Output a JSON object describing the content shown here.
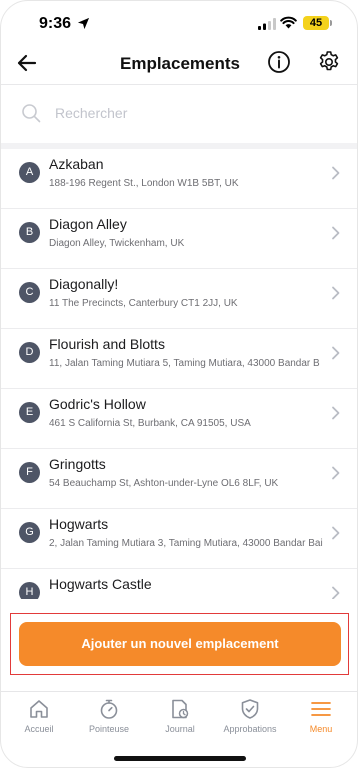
{
  "status_bar": {
    "time": "9:36",
    "battery": "45"
  },
  "header": {
    "title": "Emplacements"
  },
  "search": {
    "placeholder": "Rechercher"
  },
  "locations": [
    {
      "initial": "A",
      "name": "Azkaban",
      "address": "188-196 Regent St., London W1B 5BT, UK"
    },
    {
      "initial": "B",
      "name": "Diagon Alley",
      "address": "Diagon Alley, Twickenham, UK"
    },
    {
      "initial": "C",
      "name": "Diagonally!",
      "address": "11 The Precincts, Canterbury CT1 2JJ, UK"
    },
    {
      "initial": "D",
      "name": "Flourish and Blotts",
      "address": "11, Jalan Taming Mutiara 5, Taming Mutiara, 43000 Bandar B"
    },
    {
      "initial": "E",
      "name": "Godric's Hollow",
      "address": "461 S California St, Burbank, CA 91505, USA"
    },
    {
      "initial": "F",
      "name": "Gringotts",
      "address": "54 Beauchamp St, Ashton-under-Lyne OL6 8LF, UK"
    },
    {
      "initial": "G",
      "name": "Hogwarts",
      "address": "2, Jalan Taming Mutiara 3, Taming Mutiara, 43000 Bandar Bai"
    },
    {
      "initial": "H",
      "name": "Hogwarts Castle",
      "address": ""
    }
  ],
  "add_button": {
    "label": "Ajouter un nouvel emplacement"
  },
  "tabs": [
    {
      "label": "Accueil",
      "icon": "home-icon"
    },
    {
      "label": "Pointeuse",
      "icon": "stopwatch-icon"
    },
    {
      "label": "Journal",
      "icon": "journal-icon"
    },
    {
      "label": "Approbations",
      "icon": "shield-check-icon"
    },
    {
      "label": "Menu",
      "icon": "menu-icon",
      "active": true
    }
  ],
  "colors": {
    "accent": "#f58a2a",
    "avatar": "#4e5566",
    "highlight_frame": "#e23a3a"
  }
}
